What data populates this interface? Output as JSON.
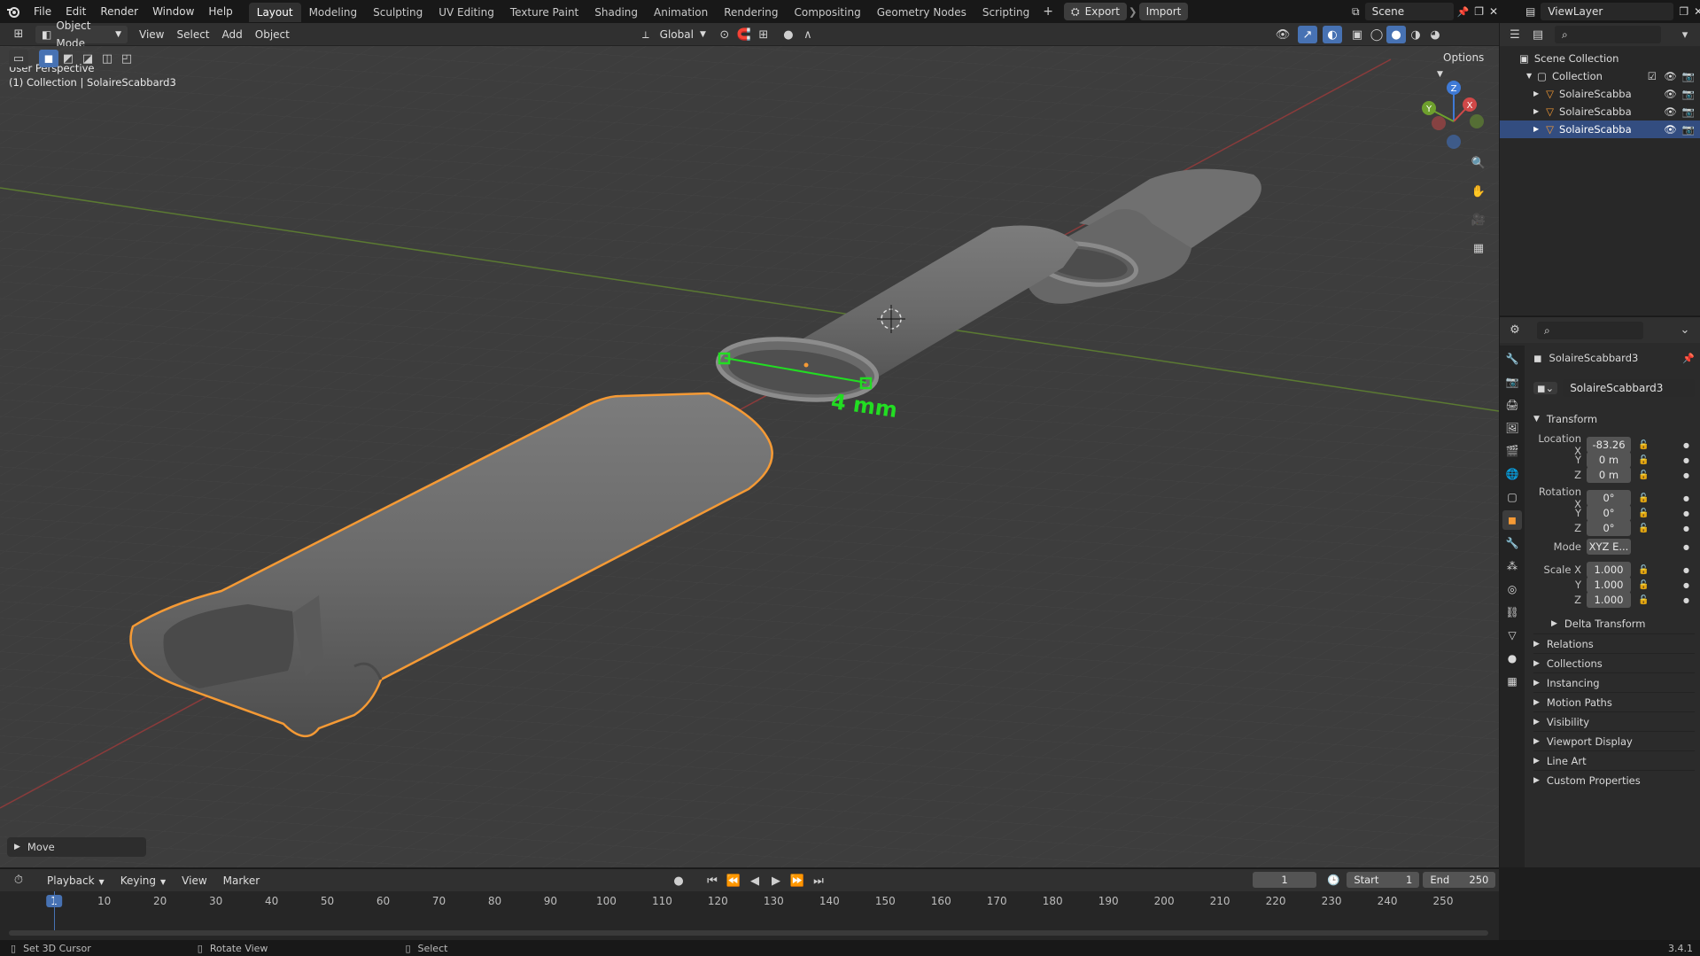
{
  "topbar": {
    "menus": [
      "File",
      "Edit",
      "Render",
      "Window",
      "Help"
    ],
    "workspaces": [
      "Layout",
      "Modeling",
      "Sculpting",
      "UV Editing",
      "Texture Paint",
      "Shading",
      "Animation",
      "Rendering",
      "Compositing",
      "Geometry Nodes",
      "Scripting"
    ],
    "active_workspace": "Layout",
    "export_label": "Export",
    "import_label": "Import",
    "scene_name": "Scene",
    "view_layer": "ViewLayer"
  },
  "viewport_header": {
    "mode": "Object Mode",
    "menus": [
      "View",
      "Select",
      "Add",
      "Object"
    ],
    "orientation": "Global",
    "options_label": "Options"
  },
  "viewport": {
    "perspective_label": "User Perspective",
    "collection_label": "(1) Collection | SolaireScabbard3",
    "measure_label": "4 mm",
    "last_op_label": "Move",
    "gizmo_axes": {
      "x": "X",
      "y": "Y",
      "z": "Z"
    }
  },
  "outliner": {
    "root": "Scene Collection",
    "collection": "Collection",
    "items": [
      "SolaireScabba",
      "SolaireScabba",
      "SolaireScabba"
    ],
    "selected_index": 2
  },
  "properties": {
    "object_name": "SolaireScabbard3",
    "data_name": "SolaireScabbard3",
    "transform_title": "Transform",
    "location_label": "Location X",
    "location": {
      "x": "-83.26",
      "y": "0 m",
      "z": "0 m"
    },
    "rotation_label": "Rotation X",
    "rotation": {
      "x": "0°",
      "y": "0°",
      "z": "0°"
    },
    "mode_label": "Mode",
    "mode_value": "XYZ E...",
    "scale_label": "Scale X",
    "scale": {
      "x": "1.000",
      "y": "1.000",
      "z": "1.000"
    },
    "axis_y": "Y",
    "axis_z": "Z",
    "delta_transform": "Delta Transform",
    "panels": [
      "Relations",
      "Collections",
      "Instancing",
      "Motion Paths",
      "Visibility",
      "Viewport Display",
      "Line Art",
      "Custom Properties"
    ]
  },
  "timeline": {
    "menus": [
      "Playback",
      "Keying",
      "View",
      "Marker"
    ],
    "current_frame": "1",
    "start_label": "Start",
    "start_value": "1",
    "end_label": "End",
    "end_value": "250",
    "ticks": [
      "1",
      "10",
      "20",
      "30",
      "40",
      "50",
      "60",
      "70",
      "80",
      "90",
      "100",
      "110",
      "120",
      "130",
      "140",
      "150",
      "160",
      "170",
      "180",
      "190",
      "200",
      "210",
      "220",
      "230",
      "240",
      "250"
    ]
  },
  "statusbar": {
    "hint1": "Set 3D Cursor",
    "hint2": "Rotate View",
    "hint3": "Select",
    "version": "3.4.1"
  },
  "colors": {
    "selection_outline": "#f59a35",
    "active_outliner": "#334d80",
    "measure_green": "#22dd22"
  }
}
